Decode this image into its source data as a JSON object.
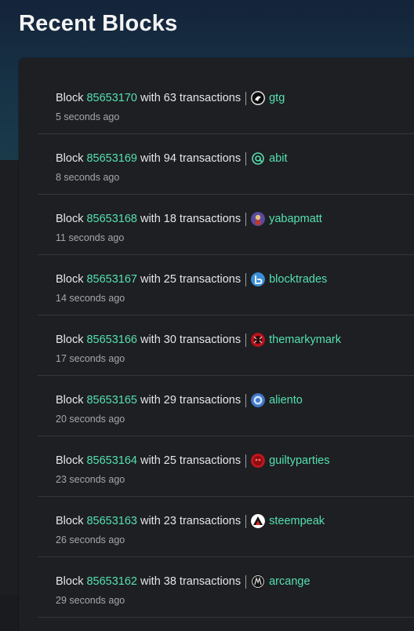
{
  "page": {
    "title": "Recent Blocks"
  },
  "labels": {
    "block_prefix": "Block",
    "with": "with",
    "transactions": "transactions"
  },
  "blocks": [
    {
      "number": "85653170",
      "tx_count": "63",
      "witness": "gtg",
      "time_ago": "5 seconds ago",
      "avatar_icon": "gtg-avatar-icon",
      "avatar_color": "#0b0b0b"
    },
    {
      "number": "85653169",
      "tx_count": "94",
      "witness": "abit",
      "time_ago": "8 seconds ago",
      "avatar_icon": "abit-at-icon",
      "avatar_color": "#54e0b0"
    },
    {
      "number": "85653168",
      "tx_count": "18",
      "witness": "yabapmatt",
      "time_ago": "11 seconds ago",
      "avatar_icon": "yabapmatt-avatar-icon",
      "avatar_color": "#5a4aa0"
    },
    {
      "number": "85653167",
      "tx_count": "25",
      "witness": "blocktrades",
      "time_ago": "14 seconds ago",
      "avatar_icon": "blocktrades-avatar-icon",
      "avatar_color": "#3a8fd8"
    },
    {
      "number": "85653166",
      "tx_count": "30",
      "witness": "themarkymark",
      "time_ago": "17 seconds ago",
      "avatar_icon": "themarkymark-avatar-icon",
      "avatar_color": "#b8121b"
    },
    {
      "number": "85653165",
      "tx_count": "29",
      "witness": "aliento",
      "time_ago": "20 seconds ago",
      "avatar_icon": "aliento-avatar-icon",
      "avatar_color": "#3f78c9"
    },
    {
      "number": "85653164",
      "tx_count": "25",
      "witness": "guiltyparties",
      "time_ago": "23 seconds ago",
      "avatar_icon": "guiltyparties-avatar-icon",
      "avatar_color": "#c4161c"
    },
    {
      "number": "85653163",
      "tx_count": "23",
      "witness": "steempeak",
      "time_ago": "26 seconds ago",
      "avatar_icon": "steempeak-avatar-icon",
      "avatar_color": "#ffffff"
    },
    {
      "number": "85653162",
      "tx_count": "38",
      "witness": "arcange",
      "time_ago": "29 seconds ago",
      "avatar_icon": "arcange-avatar-icon",
      "avatar_color": "#101010"
    }
  ],
  "colors": {
    "accent": "#54e0b0",
    "background": "#1c1e21",
    "panel": "#1e1f22",
    "text": "#e4e6e9",
    "muted": "#a4a7ab",
    "divider": "#34373b"
  }
}
